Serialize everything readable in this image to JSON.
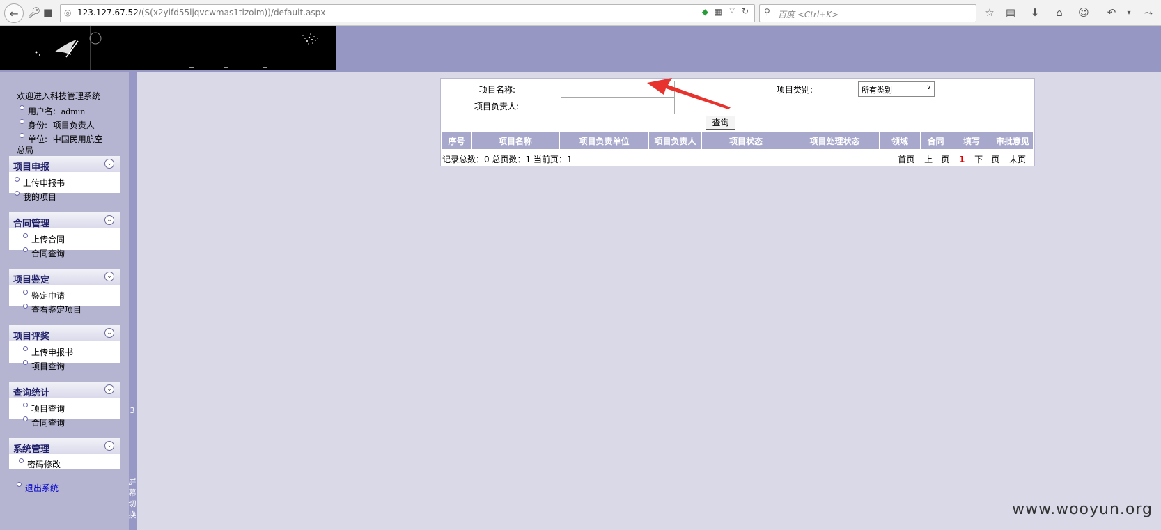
{
  "browser": {
    "url_host": "123.127.67.52",
    "url_path": "/(S(x2yifd55ljqvcwmas1tlzoim))/default.aspx",
    "search_placeholder": "百度 <Ctrl+K>"
  },
  "sidebar": {
    "welcome": "欢迎进入科技管理系统",
    "user_label": "用户名:",
    "user_value": "admin",
    "role_label": "身份:",
    "role_value": "项目负责人",
    "unit_label": "单位:",
    "unit_value": "中国民用航空",
    "unit_value_cont": "总局",
    "boxes": [
      {
        "title": "项目申报",
        "items": [
          "上传申报书",
          "我的项目"
        ]
      },
      {
        "title": "合同管理",
        "items": [
          "上传合同",
          "合同查询"
        ]
      },
      {
        "title": "项目鉴定",
        "items": [
          "鉴定申请",
          "查看鉴定项目"
        ]
      },
      {
        "title": "项目评奖",
        "items": [
          "上传申报书",
          "项目查询"
        ]
      },
      {
        "title": "查询统计",
        "items": [
          "项目查询",
          "合同查询"
        ]
      },
      {
        "title": "系统管理",
        "items": [
          "密码修改"
        ]
      }
    ],
    "logout": "退出系统",
    "edge_mark": "3",
    "switch_label": [
      "屏",
      "幕",
      "切",
      "换"
    ]
  },
  "form": {
    "name_label": "项目名称:",
    "name_value": "",
    "owner_label": "项目负责人:",
    "owner_value": "",
    "category_label": "项目类别:",
    "category_value": "所有类别",
    "query_button": "查询"
  },
  "table": {
    "headers": [
      "序号",
      "项目名称",
      "项目负责单位",
      "项目负责人",
      "项目状态",
      "项目处理状态",
      "领域",
      "合同",
      "填写",
      "审批意见"
    ],
    "rows": []
  },
  "summary": "记录总数：0 总页数：1 当前页：1",
  "pager": {
    "first": "首页",
    "prev": "上一页",
    "current": "1",
    "next": "下一页",
    "last": "末页"
  },
  "watermark": "www.wooyun.org"
}
